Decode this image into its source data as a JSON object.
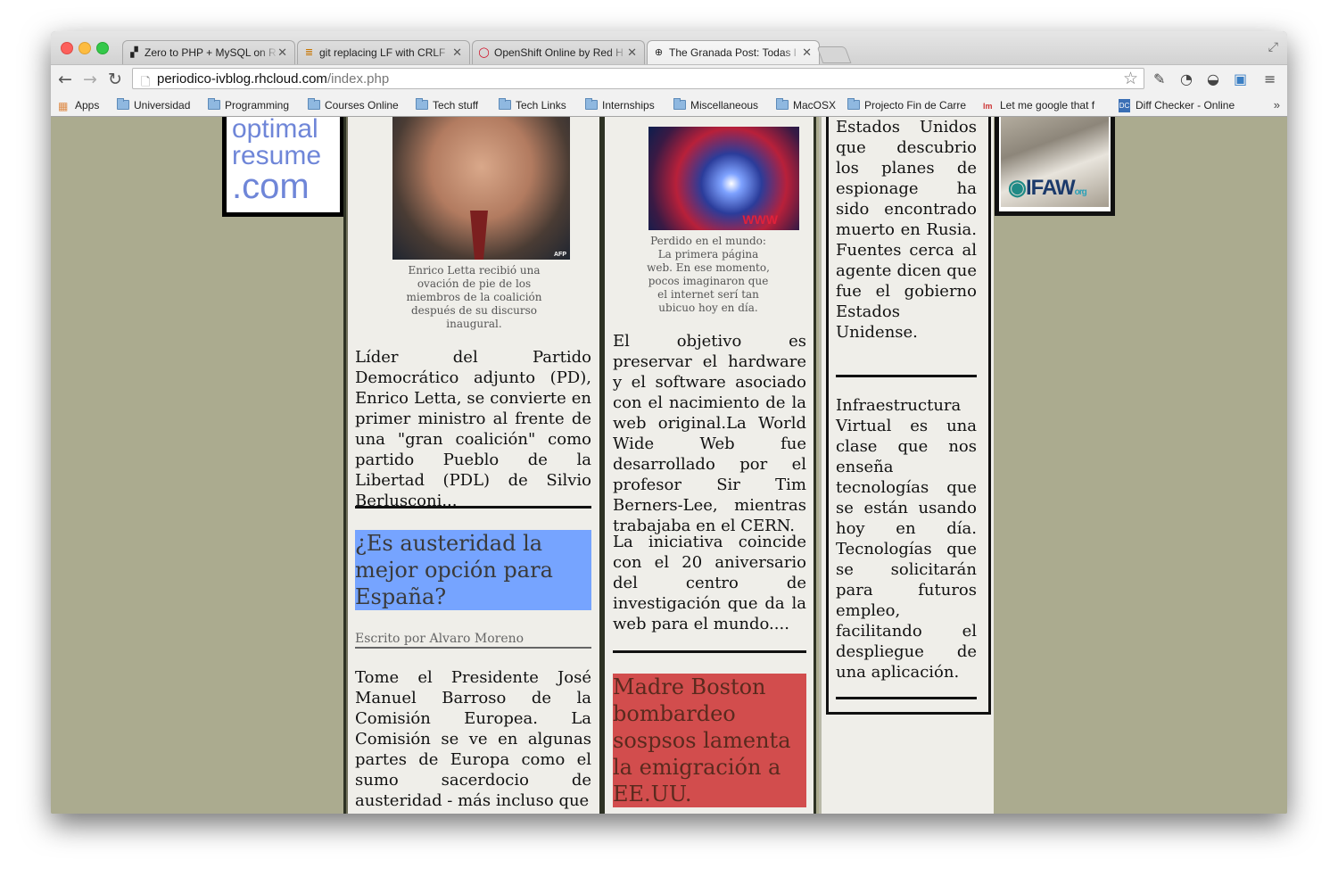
{
  "browser": {
    "tabs": [
      {
        "title": "Zero to PHP + MySQL on R",
        "active": false
      },
      {
        "title": "git replacing LF with CRLF",
        "active": false
      },
      {
        "title": "OpenShift Online by Red H",
        "active": false
      },
      {
        "title": "The Granada Post: Todas l",
        "active": true
      }
    ],
    "url_host": "periodico-ivblog.rhcloud.com",
    "url_path": "/index.php",
    "bookmarks": [
      "Apps",
      "Universidad",
      "Programming",
      "Courses Online",
      "Tech stuff",
      "Tech Links",
      "Internships",
      "Miscellaneous",
      "MacOSX",
      "Projecto Fin de Carre",
      "Let me google that f",
      "Diff Checker - Online"
    ]
  },
  "ads": {
    "left_text": [
      "optimal",
      "resume",
      ".com"
    ],
    "right_text": "IFAW",
    "right_suffix": "org"
  },
  "article1": {
    "photo_tag": "AFP",
    "caption": "Enrico Letta recibió una ovación de pie de los miembros de la coalición después de su discurso inaugural.",
    "body": "Líder del Partido Democrático adjunto (PD), Enrico Letta, se convierte en primer ministro al frente de una \"gran coalición\" como partido Pueblo de la Libertad (PDL) de Silvio Berlusconi..."
  },
  "article2": {
    "headline": "¿Es austeridad la mejor opción para España?",
    "byline": "Escrito por Alvaro Moreno",
    "body": "Tome el Presidente José Manuel Barroso de la Comisión Europea. La Comisión se ve en algunas partes de Europa como el sumo sacerdocio de austeridad - más incluso que"
  },
  "article3": {
    "photo_tag": "WWW",
    "caption": "Perdido en el mundo: La primera página web. En ese momento, pocos imaginaron que el internet serí tan ubicuo hoy en día.",
    "body1": "El objetivo es preservar el hardware y el software asociado con el nacimiento de la web original.La World Wide Web fue desarrollado por el profesor Sir Tim Berners-Lee, mientras trabajaba en el CERN.",
    "body2": "La iniciativa coincide con el 20 aniversario del centro de investigación que da la web para el mundo...."
  },
  "article4": {
    "headline": "Madre Boston bombardeo sospsos lamenta la emigración a EE.UU."
  },
  "article5": {
    "body": "Estados Unidos que descubrio los planes de espionage ha sido encontrado muerto en Rusia. Fuentes cerca al agente dicen que fue el gobierno Estados Unidense."
  },
  "article6": {
    "body": "Infraestructura Virtual es una clase que nos enseña tecnologías que se están usando hoy en día. Tecnologías que se solicitarán para futuros empleo, facilitando el despliegue de una aplicación."
  },
  "colors": {
    "page_bg": "#abab8f",
    "column_bg": "#efeee9",
    "headline_blue": "#76a4ff",
    "headline_red": "#d24d4d"
  }
}
